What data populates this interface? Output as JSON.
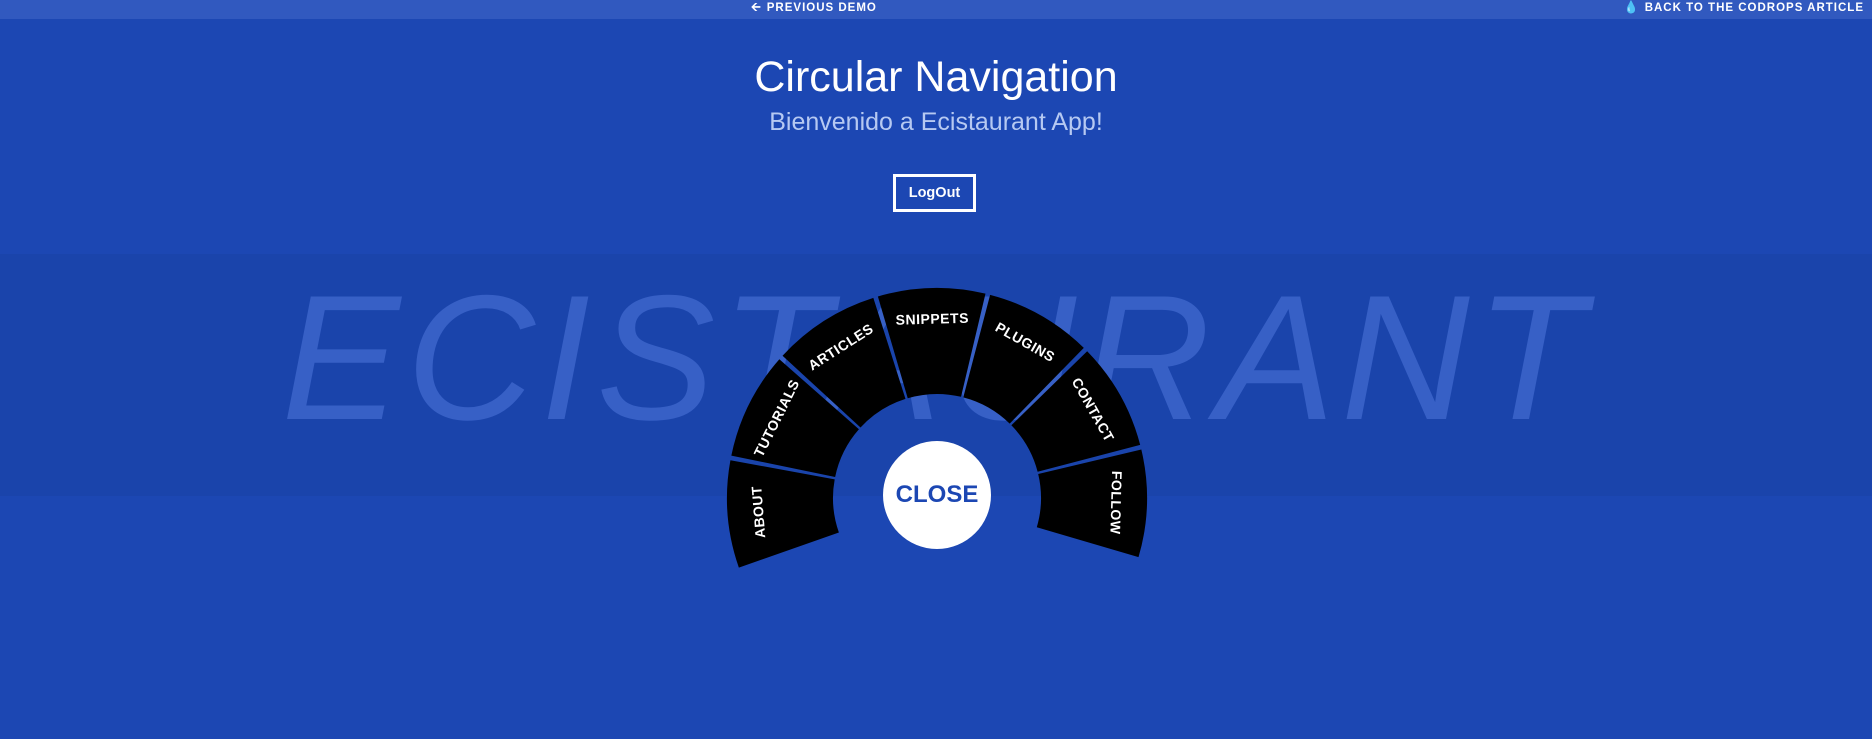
{
  "topbar": {
    "previous_demo": "PREVIOUS DEMO",
    "back_to_article": "BACK TO THE CODROPS ARTICLE"
  },
  "header": {
    "title": "Circular Navigation",
    "subtitle": "Bienvenido a Ecistaurant App!",
    "logout_label": "LogOut"
  },
  "background_word": "ECISTAURANT",
  "menu": {
    "items": [
      "ABOUT",
      "TUTORIALS",
      "ARTICLES",
      "SNIPPETS",
      "PLUGINS",
      "CONTACT",
      "FOLLOW"
    ],
    "toggle_label": "CLOSE"
  },
  "colors": {
    "background": "#1c47b3",
    "menu_segment": "#000000",
    "accent_text": "#b6c9f2"
  },
  "icons": {
    "previous_demo": "arrow-left-icon",
    "back_to_article": "drop-icon"
  }
}
